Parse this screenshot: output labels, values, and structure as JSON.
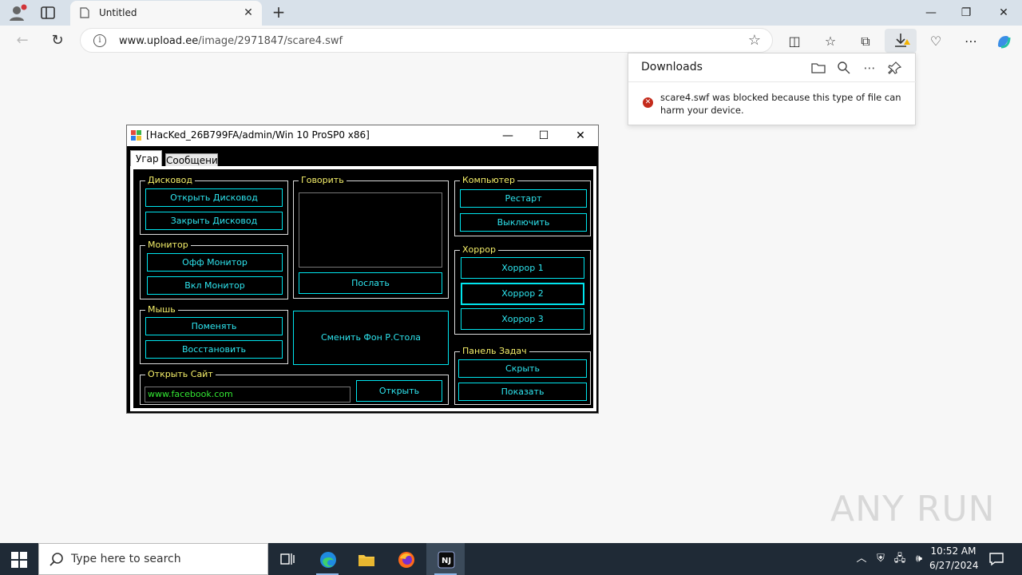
{
  "browser": {
    "tab_title": "Untitled",
    "url_host": "www.upload.ee",
    "url_path": "/image/2971847/scare4.swf"
  },
  "downloads": {
    "title": "Downloads",
    "message": "scare4.swf was blocked because this type of file can harm your device."
  },
  "app": {
    "title": "[HacKed_26B799FA/admin/Win 10 ProSP0 x86]",
    "tabs": [
      "Угар",
      "Сообщения"
    ],
    "groups": {
      "drive": {
        "label": "Дисковод",
        "open": "Открыть Дисковод",
        "close": "Закрыть Дисковод"
      },
      "monitor": {
        "label": "Монитор",
        "off": "Офф Монитор",
        "on": "Вкл Монитор"
      },
      "mouse": {
        "label": "Мышь",
        "swap": "Поменять",
        "restore": "Восстановить"
      },
      "site": {
        "label": "Открыть Сайт",
        "url_value": "www.facebook.com",
        "open": "Открыть"
      },
      "speak": {
        "label": "Говорить",
        "send": "Послать"
      },
      "wallpaper": {
        "button": "Сменить Фон Р.Стола"
      },
      "computer": {
        "label": "Компьютер",
        "restart": "Рестарт",
        "shutdown": "Выключить"
      },
      "horror": {
        "label": "Хоррор",
        "h1": "Хоррор 1",
        "h2": "Хоррор 2",
        "h3": "Хоррор 3"
      },
      "taskbar": {
        "label": "Панель Задач",
        "hide": "Скрыть",
        "show": "Показать"
      }
    }
  },
  "watermark": "ANY RUN",
  "taskbar": {
    "search_placeholder": "Type here to search",
    "time": "10:52 AM",
    "date": "6/27/2024"
  }
}
